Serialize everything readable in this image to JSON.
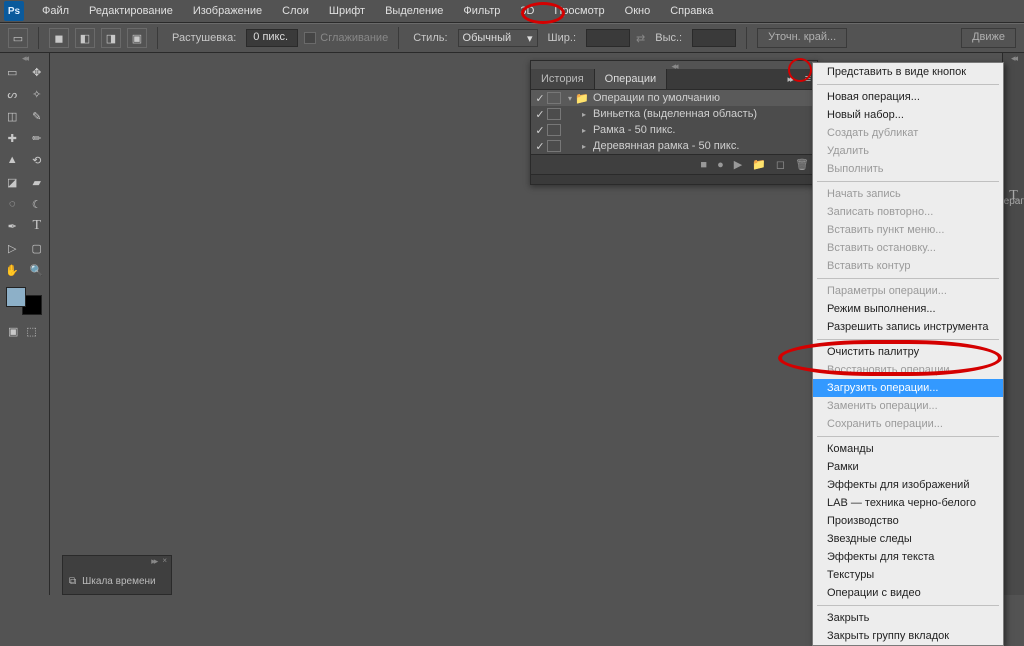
{
  "menu": [
    "Файл",
    "Редактирование",
    "Изображение",
    "Слои",
    "Шрифт",
    "Выделение",
    "Фильтр",
    "3D",
    "Просмотр",
    "Окно",
    "Справка"
  ],
  "optbar": {
    "feather_label": "Растушевка:",
    "feather_value": "0 пикс.",
    "antialias": "Сглаживание",
    "style_label": "Стиль:",
    "style_value": "Обычный",
    "width_label": "Шир.:",
    "height_label": "Выс.:",
    "refine": "Уточн. край...",
    "motion": "Движе"
  },
  "panel": {
    "tab_history": "История",
    "tab_actions": "Операции",
    "set": "Операции по умолчанию",
    "items": [
      "Виньетка (выделенная область)",
      "Рамка - 50 пикс.",
      "Деревянная рамка - 50 пикс."
    ]
  },
  "flyout": {
    "g1": [
      "Представить в виде кнопок"
    ],
    "g2": [
      "Новая операция...",
      "Новый набор...",
      "Создать дубликат",
      "Удалить",
      "Выполнить"
    ],
    "g3": [
      "Начать запись",
      "Записать повторно...",
      "Вставить пункт меню...",
      "Вставить остановку...",
      "Вставить контур"
    ],
    "g4": [
      "Параметры операции...",
      "Режим выполнения...",
      "Разрешить запись инструмента"
    ],
    "g5": [
      "Очистить палитру",
      "Восстановить операции",
      "Загрузить операции...",
      "Заменить операции...",
      "Сохранить операции..."
    ],
    "g6": [
      "Команды",
      "Рамки",
      "Эффекты для изображений",
      "LAB — техника черно-белого",
      "Производство",
      "Звездные следы",
      "Эффекты для текста",
      "Текстуры",
      "Операции с видео"
    ],
    "g7": [
      "Закрыть",
      "Закрыть группу вкладок"
    ]
  },
  "timeline": "Шкала времени",
  "right_label": "Нераг"
}
